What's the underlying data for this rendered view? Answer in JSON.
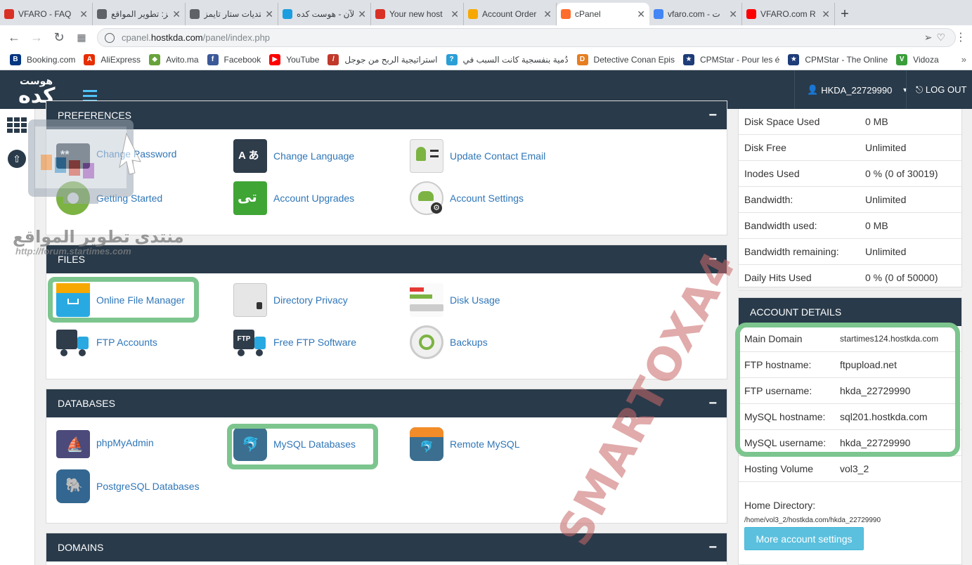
{
  "browser": {
    "tabs": [
      {
        "title": "VFARO - FAQ",
        "fav_color": "#d93025",
        "active": false
      },
      {
        "title": "تيجز: تطوير المواقع",
        "fav_color": "#5f6368",
        "active": false
      },
      {
        "title": "منتديات ستار تايمز",
        "fav_color": "#5f6368",
        "active": false
      },
      {
        "title": "الآن - هوست كده",
        "fav_color": "#1a9ee0",
        "active": false
      },
      {
        "title": "Your new host",
        "fav_color": "#d93025",
        "active": false
      },
      {
        "title": "Account Order",
        "fav_color": "#f6a800",
        "active": false
      },
      {
        "title": "cPanel",
        "fav_color": "#ff6c2c",
        "active": true
      },
      {
        "title": "vfaro.com - ت",
        "fav_color": "#4285f4",
        "active": false
      },
      {
        "title": "VFARO.com R",
        "fav_color": "#ff0000",
        "active": false
      }
    ],
    "url_host": "cpanel.",
    "url_domain": "hostkda.com",
    "url_path": "/panel/index.php",
    "bookmarks": [
      {
        "label": "Booking.com",
        "color": "#003580",
        "glyph": "B"
      },
      {
        "label": "AliExpress",
        "color": "#e62e04",
        "glyph": "A"
      },
      {
        "label": "Avito.ma",
        "color": "#67a33a",
        "glyph": "◆"
      },
      {
        "label": "Facebook",
        "color": "#3b5998",
        "glyph": "f"
      },
      {
        "label": "YouTube",
        "color": "#ff0000",
        "glyph": "▶"
      },
      {
        "label": "استراتيجية الربح من جوجل",
        "color": "#c0392b",
        "glyph": "/"
      },
      {
        "label": "دُمية بنفسجية كانت السبب في",
        "color": "#2a9fd6",
        "glyph": "?"
      },
      {
        "label": "Detective Conan Epis",
        "color": "#e67e22",
        "glyph": "D"
      },
      {
        "label": "CPMStar - Pour les é",
        "color": "#1d3c78",
        "glyph": "★"
      },
      {
        "label": "CPMStar - The Online",
        "color": "#1d3c78",
        "glyph": "★"
      },
      {
        "label": "Vidoza",
        "color": "#3a9e3a",
        "glyph": "V"
      }
    ]
  },
  "header": {
    "username": "HKDA_22729990",
    "logout": "LOG OUT",
    "logo_text": "هوست كده"
  },
  "preferences": {
    "title": "PREFERENCES",
    "items": [
      {
        "label": "Change Password",
        "icon": "password-icon"
      },
      {
        "label": "Change Language",
        "icon": "language-icon"
      },
      {
        "label": "Update Contact Email",
        "icon": "contact-card-icon"
      },
      {
        "label": "Getting Started",
        "icon": "getting-started-icon"
      },
      {
        "label": "Account Upgrades",
        "icon": "upgrade-icon"
      },
      {
        "label": "Account Settings",
        "icon": "account-settings-icon"
      }
    ]
  },
  "files": {
    "title": "FILES",
    "items": [
      {
        "label": "Online File Manager",
        "icon": "file-manager-icon"
      },
      {
        "label": "Directory Privacy",
        "icon": "folder-lock-icon"
      },
      {
        "label": "Disk Usage",
        "icon": "disk-usage-icon"
      },
      {
        "label": "FTP Accounts",
        "icon": "ftp-accounts-icon"
      },
      {
        "label": "Free FTP Software",
        "icon": "ftp-software-icon"
      },
      {
        "label": "Backups",
        "icon": "backups-icon"
      }
    ]
  },
  "databases": {
    "title": "DATABASES",
    "items": [
      {
        "label": "phpMyAdmin",
        "icon": "phpmyadmin-icon"
      },
      {
        "label": "MySQL Databases",
        "icon": "mysql-icon"
      },
      {
        "label": "Remote MySQL",
        "icon": "remote-mysql-icon"
      },
      {
        "label": "PostgreSQL Databases",
        "icon": "postgresql-icon"
      }
    ]
  },
  "domains": {
    "title": "DOMAINS"
  },
  "stats": [
    {
      "k": "Disk Space Used",
      "v": "0 MB"
    },
    {
      "k": "Disk Free",
      "v": "Unlimited"
    },
    {
      "k": "Inodes Used",
      "v": "0 % (0 of 30019)"
    },
    {
      "k": "Bandwidth:",
      "v": "Unlimited"
    },
    {
      "k": "Bandwidth used:",
      "v": "0 MB"
    },
    {
      "k": "Bandwidth remaining:",
      "v": "Unlimited"
    },
    {
      "k": "Daily Hits Used",
      "v": "0 % (0 of 50000)"
    }
  ],
  "account": {
    "title": "ACCOUNT DETAILS",
    "rows": [
      {
        "k": "Main Domain",
        "v": "startimes124.hostkda.com"
      },
      {
        "k": "FTP hostname:",
        "v": "ftpupload.net"
      },
      {
        "k": "FTP username:",
        "v": "hkda_22729990"
      },
      {
        "k": "MySQL hostname:",
        "v": "sql201.hostkda.com"
      },
      {
        "k": "MySQL username:",
        "v": "hkda_22729990"
      },
      {
        "k": "Hosting Volume",
        "v": "vol3_2"
      }
    ],
    "home_label": "Home Directory:",
    "home_value": "/home/vol3_2/hostkda.com/hkda_22729990",
    "more_button": "More account settings"
  },
  "watermarks": {
    "arabic": "منتدى تطوير المواقع",
    "url": "http://forum.startimes.com",
    "diagonal": "SMARTOXA4"
  },
  "colors": {
    "header_bg": "#293a4a",
    "link": "#2f76b8",
    "highlight": "#7cc58e",
    "button": "#5bc0de"
  }
}
